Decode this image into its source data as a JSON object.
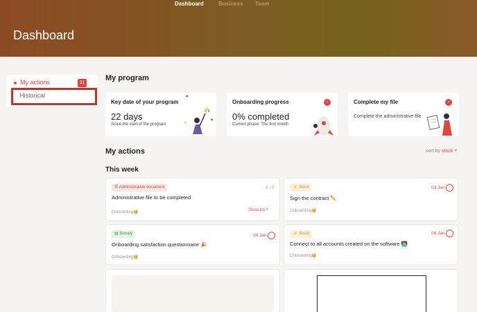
{
  "nav": {
    "items": [
      "Dashboard",
      "Business",
      "Team"
    ]
  },
  "header": {
    "title": "Dashboard"
  },
  "sidebar": {
    "actions_label": "My actions",
    "actions_count": "11",
    "historical_label": "Historical"
  },
  "program": {
    "heading": "My program",
    "cards": [
      {
        "title": "Key date of your program",
        "value": "22 days",
        "subtitle": "Since the start of the program"
      },
      {
        "title": "Onboarding progress",
        "value": "0% completed",
        "subtitle": "Current phase: The first month"
      },
      {
        "title": "Complete my file",
        "subtitle": "Complete the administrative file"
      }
    ]
  },
  "actions": {
    "heading": "My actions",
    "sort_label": "sort by",
    "sort_value": "stock",
    "week_heading": "This week",
    "tasks": [
      {
        "tag": "Administrative document",
        "title": "Administrative file to be completed",
        "footer": "Onboarding🥳",
        "count": "0 / 2",
        "show_list": "Show list"
      },
      {
        "tag": "Stock",
        "title": "Sign the contract ✏️",
        "footer": "Onboarding🥳",
        "date": "03 Jan"
      },
      {
        "tag": "Survey",
        "title": "Onboarding satisfaction questionnaire 🎉",
        "footer": "Onboarding🥳",
        "date": "04 Jan"
      },
      {
        "tag": "Stock",
        "title": "Connect to all accounts created on the software 👨‍💻",
        "footer": "Onboarding🥳",
        "date": "04 Jan"
      }
    ]
  },
  "colors": {
    "accent": "#e0463c",
    "header_start": "#8c4a24",
    "header_end": "#74621f"
  }
}
